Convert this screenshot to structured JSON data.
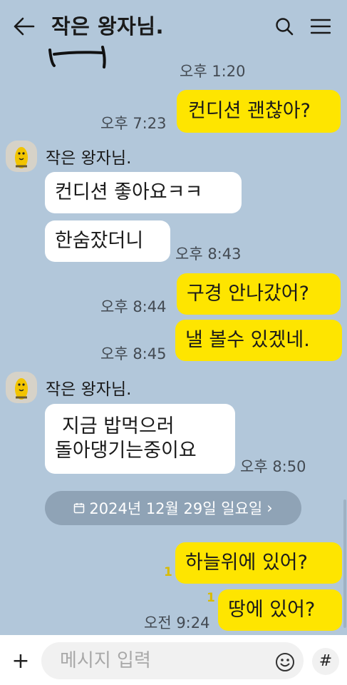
{
  "header": {
    "title": "작은 왕자님.",
    "back_icon": "arrow-left-icon",
    "search_icon": "search-icon",
    "menu_icon": "hamburger-menu-icon"
  },
  "colors": {
    "background": "#b2c7da",
    "my_bubble": "#fee500",
    "their_bubble": "#ffffff",
    "unread_count": "#d9bb00"
  },
  "messages": [
    {
      "time": "오후 1:20"
    },
    {
      "from": "me",
      "text": "컨디션 괜찮아?",
      "time": "오후 7:23"
    },
    {
      "from": "them",
      "sender": "작은 왕자님.",
      "text": "컨디션 좋아요ㅋㅋ"
    },
    {
      "from": "them",
      "text": "한숨잤더니",
      "time": "오후 8:43"
    },
    {
      "from": "me",
      "text": "구경 안나갔어?",
      "time": "오후 8:44"
    },
    {
      "from": "me",
      "text": "낼 볼수 있겠네.",
      "time": "오후 8:45"
    },
    {
      "from": "them",
      "sender": "작은 왕자님.",
      "text_lines": [
        "지금 밥먹으러",
        "돌아댕기는중이요"
      ],
      "time": "오후 8:50"
    },
    {
      "from": "me",
      "text": "하늘위에 있어?",
      "unread": "1"
    },
    {
      "from": "me",
      "text": "땅에 있어?",
      "unread": "1",
      "time": "오전 9:24"
    }
  ],
  "date_divider": {
    "icon": "calendar-icon",
    "label": "2024년 12월 29일 일요일",
    "chevron": "›"
  },
  "composer": {
    "plus_label": "+",
    "placeholder": "메시지 입력",
    "emoji_icon": "emoji-smile-icon",
    "hash_label": "#"
  }
}
